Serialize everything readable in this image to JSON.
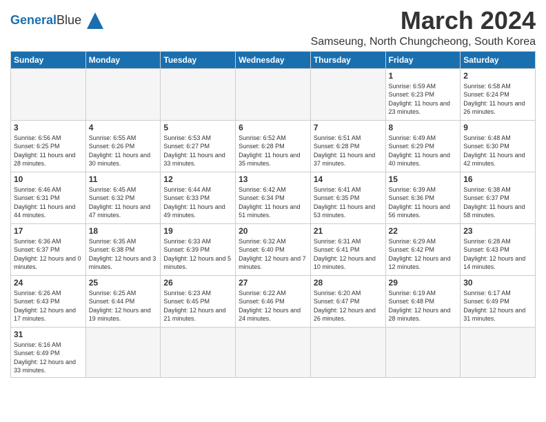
{
  "logo": {
    "text_general": "General",
    "text_blue": "Blue"
  },
  "title": "March 2024",
  "subtitle": "Samseung, North Chungcheong, South Korea",
  "headers": [
    "Sunday",
    "Monday",
    "Tuesday",
    "Wednesday",
    "Thursday",
    "Friday",
    "Saturday"
  ],
  "weeks": [
    [
      {
        "day": "",
        "info": ""
      },
      {
        "day": "",
        "info": ""
      },
      {
        "day": "",
        "info": ""
      },
      {
        "day": "",
        "info": ""
      },
      {
        "day": "",
        "info": ""
      },
      {
        "day": "1",
        "info": "Sunrise: 6:59 AM\nSunset: 6:23 PM\nDaylight: 11 hours\nand 23 minutes."
      },
      {
        "day": "2",
        "info": "Sunrise: 6:58 AM\nSunset: 6:24 PM\nDaylight: 11 hours\nand 26 minutes."
      }
    ],
    [
      {
        "day": "3",
        "info": "Sunrise: 6:56 AM\nSunset: 6:25 PM\nDaylight: 11 hours\nand 28 minutes."
      },
      {
        "day": "4",
        "info": "Sunrise: 6:55 AM\nSunset: 6:26 PM\nDaylight: 11 hours\nand 30 minutes."
      },
      {
        "day": "5",
        "info": "Sunrise: 6:53 AM\nSunset: 6:27 PM\nDaylight: 11 hours\nand 33 minutes."
      },
      {
        "day": "6",
        "info": "Sunrise: 6:52 AM\nSunset: 6:28 PM\nDaylight: 11 hours\nand 35 minutes."
      },
      {
        "day": "7",
        "info": "Sunrise: 6:51 AM\nSunset: 6:28 PM\nDaylight: 11 hours\nand 37 minutes."
      },
      {
        "day": "8",
        "info": "Sunrise: 6:49 AM\nSunset: 6:29 PM\nDaylight: 11 hours\nand 40 minutes."
      },
      {
        "day": "9",
        "info": "Sunrise: 6:48 AM\nSunset: 6:30 PM\nDaylight: 11 hours\nand 42 minutes."
      }
    ],
    [
      {
        "day": "10",
        "info": "Sunrise: 6:46 AM\nSunset: 6:31 PM\nDaylight: 11 hours\nand 44 minutes."
      },
      {
        "day": "11",
        "info": "Sunrise: 6:45 AM\nSunset: 6:32 PM\nDaylight: 11 hours\nand 47 minutes."
      },
      {
        "day": "12",
        "info": "Sunrise: 6:44 AM\nSunset: 6:33 PM\nDaylight: 11 hours\nand 49 minutes."
      },
      {
        "day": "13",
        "info": "Sunrise: 6:42 AM\nSunset: 6:34 PM\nDaylight: 11 hours\nand 51 minutes."
      },
      {
        "day": "14",
        "info": "Sunrise: 6:41 AM\nSunset: 6:35 PM\nDaylight: 11 hours\nand 53 minutes."
      },
      {
        "day": "15",
        "info": "Sunrise: 6:39 AM\nSunset: 6:36 PM\nDaylight: 11 hours\nand 56 minutes."
      },
      {
        "day": "16",
        "info": "Sunrise: 6:38 AM\nSunset: 6:37 PM\nDaylight: 11 hours\nand 58 minutes."
      }
    ],
    [
      {
        "day": "17",
        "info": "Sunrise: 6:36 AM\nSunset: 6:37 PM\nDaylight: 12 hours\nand 0 minutes."
      },
      {
        "day": "18",
        "info": "Sunrise: 6:35 AM\nSunset: 6:38 PM\nDaylight: 12 hours\nand 3 minutes."
      },
      {
        "day": "19",
        "info": "Sunrise: 6:33 AM\nSunset: 6:39 PM\nDaylight: 12 hours\nand 5 minutes."
      },
      {
        "day": "20",
        "info": "Sunrise: 6:32 AM\nSunset: 6:40 PM\nDaylight: 12 hours\nand 7 minutes."
      },
      {
        "day": "21",
        "info": "Sunrise: 6:31 AM\nSunset: 6:41 PM\nDaylight: 12 hours\nand 10 minutes."
      },
      {
        "day": "22",
        "info": "Sunrise: 6:29 AM\nSunset: 6:42 PM\nDaylight: 12 hours\nand 12 minutes."
      },
      {
        "day": "23",
        "info": "Sunrise: 6:28 AM\nSunset: 6:43 PM\nDaylight: 12 hours\nand 14 minutes."
      }
    ],
    [
      {
        "day": "24",
        "info": "Sunrise: 6:26 AM\nSunset: 6:43 PM\nDaylight: 12 hours\nand 17 minutes."
      },
      {
        "day": "25",
        "info": "Sunrise: 6:25 AM\nSunset: 6:44 PM\nDaylight: 12 hours\nand 19 minutes."
      },
      {
        "day": "26",
        "info": "Sunrise: 6:23 AM\nSunset: 6:45 PM\nDaylight: 12 hours\nand 21 minutes."
      },
      {
        "day": "27",
        "info": "Sunrise: 6:22 AM\nSunset: 6:46 PM\nDaylight: 12 hours\nand 24 minutes."
      },
      {
        "day": "28",
        "info": "Sunrise: 6:20 AM\nSunset: 6:47 PM\nDaylight: 12 hours\nand 26 minutes."
      },
      {
        "day": "29",
        "info": "Sunrise: 6:19 AM\nSunset: 6:48 PM\nDaylight: 12 hours\nand 28 minutes."
      },
      {
        "day": "30",
        "info": "Sunrise: 6:17 AM\nSunset: 6:49 PM\nDaylight: 12 hours\nand 31 minutes."
      }
    ],
    [
      {
        "day": "31",
        "info": "Sunrise: 6:16 AM\nSunset: 6:49 PM\nDaylight: 12 hours\nand 33 minutes."
      },
      {
        "day": "",
        "info": ""
      },
      {
        "day": "",
        "info": ""
      },
      {
        "day": "",
        "info": ""
      },
      {
        "day": "",
        "info": ""
      },
      {
        "day": "",
        "info": ""
      },
      {
        "day": "",
        "info": ""
      }
    ]
  ]
}
